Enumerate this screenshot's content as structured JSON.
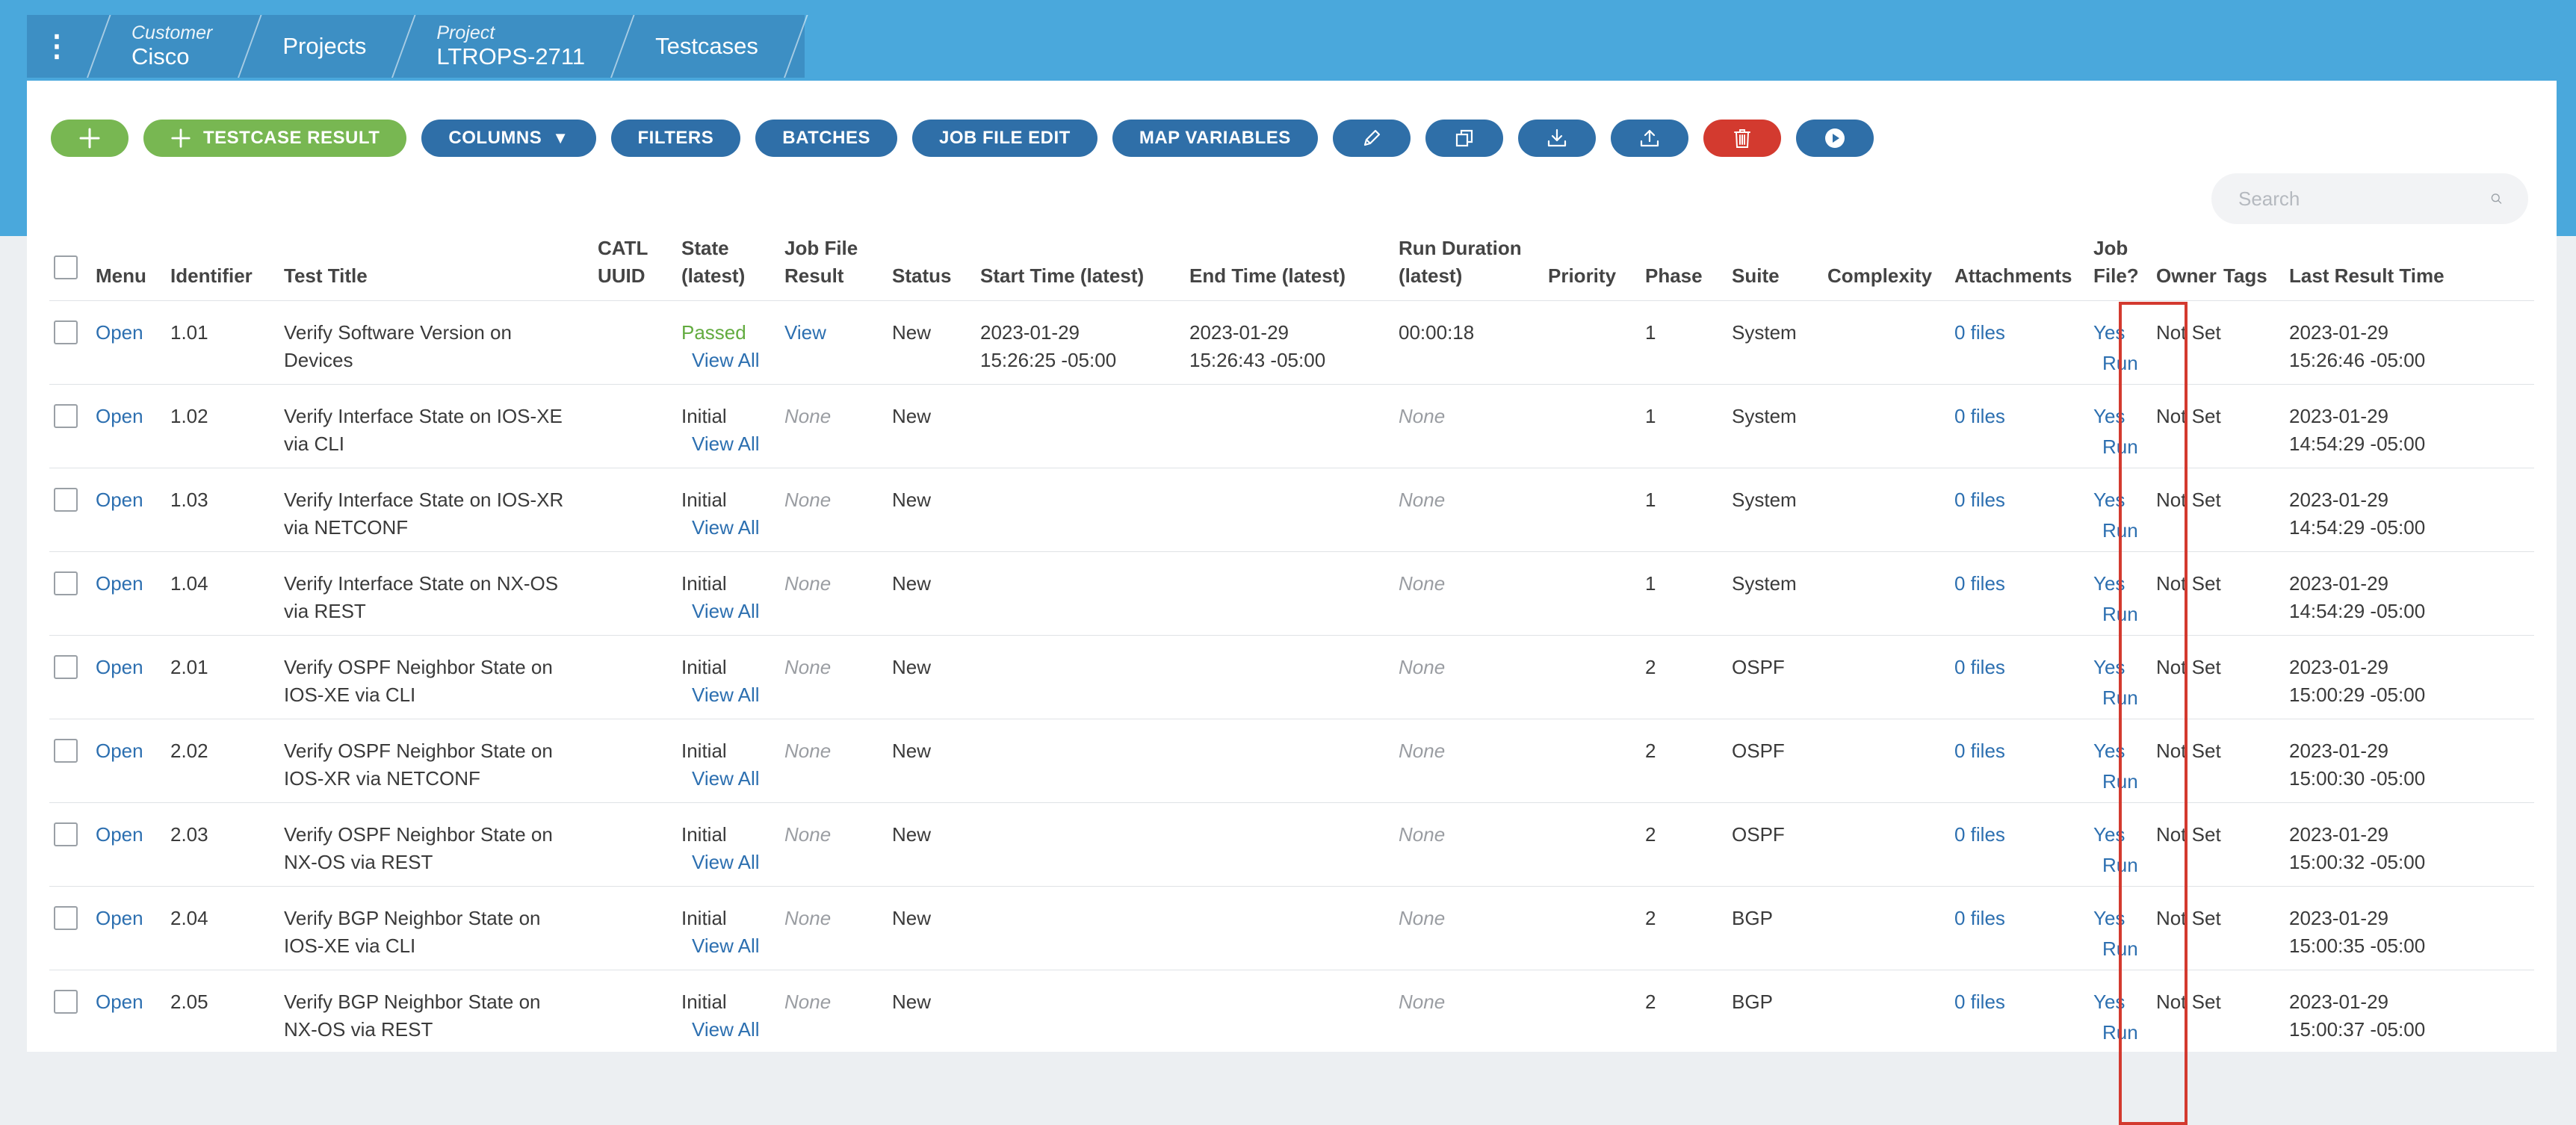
{
  "breadcrumb": {
    "segments": [
      {
        "small": "Customer",
        "big": "Cisco"
      },
      {
        "small": "",
        "big": "Projects"
      },
      {
        "small": "Project",
        "big": "LTROPS-2711"
      },
      {
        "small": "",
        "big": "Testcases"
      }
    ]
  },
  "toolbar": {
    "testcase_result": "TESTCASE RESULT",
    "columns": "COLUMNS",
    "filters": "FILTERS",
    "batches": "BATCHES",
    "job_file_edit": "JOB FILE EDIT",
    "map_variables": "MAP VARIABLES"
  },
  "search": {
    "placeholder": "Search"
  },
  "columns": {
    "menu": "Menu",
    "identifier": "Identifier",
    "test_title": "Test Title",
    "catl_uuid_1": "CATL",
    "catl_uuid_2": "UUID",
    "state_1": "State",
    "state_2": "(latest)",
    "job_result_1": "Job File",
    "job_result_2": "Result",
    "status": "Status",
    "start_time": "Start Time (latest)",
    "end_time": "End Time (latest)",
    "run_duration_1": "Run Duration",
    "run_duration_2": "(latest)",
    "priority": "Priority",
    "phase": "Phase",
    "suite": "Suite",
    "complexity": "Complexity",
    "attachments": "Attachments",
    "job_file_1": "Job",
    "job_file_2": "File?",
    "owner": "Owner",
    "tags": "Tags",
    "last_result_time": "Last Result Time"
  },
  "rows": [
    {
      "menu": "Open",
      "id": "1.01",
      "title1": "Verify Software Version on",
      "title2": "Devices",
      "state": "Passed",
      "view_all": "View All",
      "job_result": "View",
      "status": "New",
      "start1": "2023-01-29",
      "start2": "15:26:25 -05:00",
      "end1": "2023-01-29",
      "end2": "15:26:43 -05:00",
      "duration": "00:00:18",
      "phase": "1",
      "suite": "System",
      "attachments": "0 files",
      "job": "Yes",
      "run": "Run",
      "owner": "Not Set",
      "last1": "2023-01-29",
      "last2": "15:26:46 -05:00"
    },
    {
      "menu": "Open",
      "id": "1.02",
      "title1": "Verify Interface State on IOS-XE",
      "title2": "via CLI",
      "state": "Initial",
      "view_all": "View All",
      "job_result": "None",
      "status": "New",
      "start1": "",
      "start2": "",
      "end1": "",
      "end2": "",
      "duration": "None",
      "phase": "1",
      "suite": "System",
      "attachments": "0 files",
      "job": "Yes",
      "run": "Run",
      "owner": "Not Set",
      "last1": "2023-01-29",
      "last2": "14:54:29 -05:00"
    },
    {
      "menu": "Open",
      "id": "1.03",
      "title1": "Verify Interface State on IOS-XR",
      "title2": "via NETCONF",
      "state": "Initial",
      "view_all": "View All",
      "job_result": "None",
      "status": "New",
      "start1": "",
      "start2": "",
      "end1": "",
      "end2": "",
      "duration": "None",
      "phase": "1",
      "suite": "System",
      "attachments": "0 files",
      "job": "Yes",
      "run": "Run",
      "owner": "Not Set",
      "last1": "2023-01-29",
      "last2": "14:54:29 -05:00"
    },
    {
      "menu": "Open",
      "id": "1.04",
      "title1": "Verify Interface State on NX-OS",
      "title2": "via REST",
      "state": "Initial",
      "view_all": "View All",
      "job_result": "None",
      "status": "New",
      "start1": "",
      "start2": "",
      "end1": "",
      "end2": "",
      "duration": "None",
      "phase": "1",
      "suite": "System",
      "attachments": "0 files",
      "job": "Yes",
      "run": "Run",
      "owner": "Not Set",
      "last1": "2023-01-29",
      "last2": "14:54:29 -05:00"
    },
    {
      "menu": "Open",
      "id": "2.01",
      "title1": "Verify OSPF Neighbor State on",
      "title2": "IOS-XE via CLI",
      "state": "Initial",
      "view_all": "View All",
      "job_result": "None",
      "status": "New",
      "start1": "",
      "start2": "",
      "end1": "",
      "end2": "",
      "duration": "None",
      "phase": "2",
      "suite": "OSPF",
      "attachments": "0 files",
      "job": "Yes",
      "run": "Run",
      "owner": "Not Set",
      "last1": "2023-01-29",
      "last2": "15:00:29 -05:00"
    },
    {
      "menu": "Open",
      "id": "2.02",
      "title1": "Verify OSPF Neighbor State on",
      "title2": "IOS-XR via NETCONF",
      "state": "Initial",
      "view_all": "View All",
      "job_result": "None",
      "status": "New",
      "start1": "",
      "start2": "",
      "end1": "",
      "end2": "",
      "duration": "None",
      "phase": "2",
      "suite": "OSPF",
      "attachments": "0 files",
      "job": "Yes",
      "run": "Run",
      "owner": "Not Set",
      "last1": "2023-01-29",
      "last2": "15:00:30 -05:00"
    },
    {
      "menu": "Open",
      "id": "2.03",
      "title1": "Verify OSPF Neighbor State on",
      "title2": "NX-OS via REST",
      "state": "Initial",
      "view_all": "View All",
      "job_result": "None",
      "status": "New",
      "start1": "",
      "start2": "",
      "end1": "",
      "end2": "",
      "duration": "None",
      "phase": "2",
      "suite": "OSPF",
      "attachments": "0 files",
      "job": "Yes",
      "run": "Run",
      "owner": "Not Set",
      "last1": "2023-01-29",
      "last2": "15:00:32 -05:00"
    },
    {
      "menu": "Open",
      "id": "2.04",
      "title1": "Verify BGP Neighbor State on",
      "title2": "IOS-XE via CLI",
      "state": "Initial",
      "view_all": "View All",
      "job_result": "None",
      "status": "New",
      "start1": "",
      "start2": "",
      "end1": "",
      "end2": "",
      "duration": "None",
      "phase": "2",
      "suite": "BGP",
      "attachments": "0 files",
      "job": "Yes",
      "run": "Run",
      "owner": "Not Set",
      "last1": "2023-01-29",
      "last2": "15:00:35 -05:00"
    },
    {
      "menu": "Open",
      "id": "2.05",
      "title1": "Verify BGP Neighbor State on",
      "title2": "NX-OS via REST",
      "state": "Initial",
      "view_all": "View All",
      "job_result": "None",
      "status": "New",
      "start1": "",
      "start2": "",
      "end1": "",
      "end2": "",
      "duration": "None",
      "phase": "2",
      "suite": "BGP",
      "attachments": "0 files",
      "job": "Yes",
      "run": "Run",
      "owner": "Not Set",
      "last1": "2023-01-29",
      "last2": "15:00:37 -05:00"
    }
  ],
  "colors": {
    "header": "#4aa8dc",
    "button": "#2f6fa8",
    "green": "#78b752",
    "red": "#d33a2f",
    "link": "#2c6fb0"
  }
}
